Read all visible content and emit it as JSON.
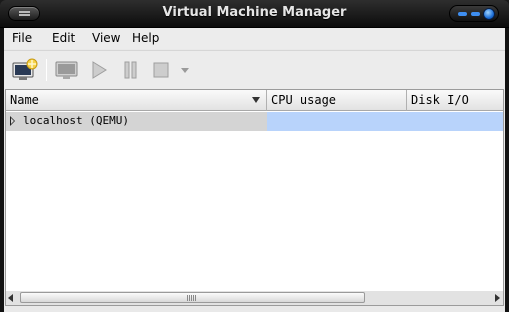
{
  "window": {
    "title": "Virtual Machine Manager"
  },
  "menubar": {
    "items": [
      "File",
      "Edit",
      "View",
      "Help"
    ]
  },
  "toolbar": {
    "buttons": [
      {
        "name": "new-vm",
        "icon": "new-vm-icon"
      },
      {
        "name": "open-console",
        "icon": "monitor-icon"
      },
      {
        "name": "run",
        "icon": "play-icon"
      },
      {
        "name": "pause",
        "icon": "pause-icon"
      },
      {
        "name": "shutdown",
        "icon": "stop-icon"
      },
      {
        "name": "shutdown-menu",
        "icon": "dropdown-arrow-icon"
      }
    ]
  },
  "list": {
    "columns": [
      "Name",
      "CPU usage",
      "Disk I/O"
    ],
    "rows": [
      {
        "name": "localhost (QEMU)",
        "expanded": false
      }
    ]
  },
  "colors": {
    "selection": "#b8d3fb",
    "row_name_bg": "#d4d4d4",
    "accent": "#3e8ef0"
  }
}
